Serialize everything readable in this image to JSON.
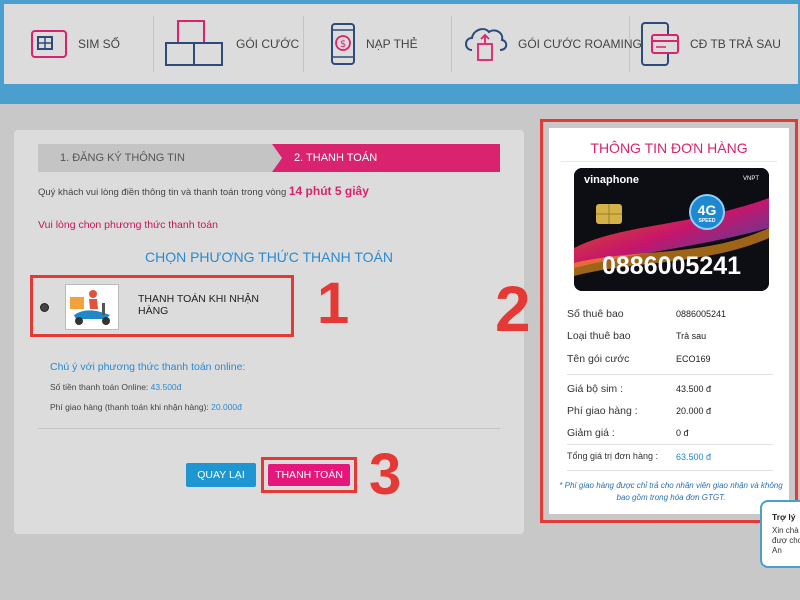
{
  "nav": {
    "items": [
      {
        "label": "SIM SỐ",
        "icon": "sim-card-icon"
      },
      {
        "label": "GÓI CƯỚC",
        "icon": "package-boxes-icon"
      },
      {
        "label": "NẠP THẺ",
        "icon": "phone-topup-icon"
      },
      {
        "label": "GÓI CƯỚC ROAMING",
        "icon": "cloud-roaming-icon"
      },
      {
        "label": "CĐ TB TRẢ SAU",
        "icon": "postpaid-phone-icon"
      }
    ]
  },
  "steps": {
    "step1": "1. ĐĂNG KÝ THÔNG TIN",
    "step2": "2. THANH TOÁN"
  },
  "notice": {
    "text": "Quý khách vui lòng điền thông tin và thanh toán trong vòng ",
    "time": "14 phút 5 giây"
  },
  "choose_hint": "Vui lòng chọn phương thức thanh toán",
  "section_title": "CHỌN PHƯƠNG THỨC THANH TOÁN",
  "payment_option": {
    "label": "THANH TOÁN KHI NHẬN HÀNG",
    "selected": true
  },
  "online_note": {
    "title": "Chú ý với phương thức thanh toán online:",
    "amount_label": "Số tiền thanh toán Online: ",
    "amount_value": "43.500đ",
    "shipping_label": "Phí giao hàng (thanh toán khi nhận hàng): ",
    "shipping_value": "20.000đ"
  },
  "buttons": {
    "back": "QUAY LẠI",
    "pay": "THANH TOÁN"
  },
  "annotations": {
    "n1": "1",
    "n2": "2",
    "n3": "3"
  },
  "order": {
    "title": "THÔNG TIN ĐƠN HÀNG",
    "card": {
      "brand": "vinaphone",
      "vnpt": "VNPT",
      "badge": "4G",
      "badge_sub": "SPEED",
      "number": "0886005241"
    },
    "rows": [
      {
        "label": "Số thuê bao",
        "value": "0886005241"
      },
      {
        "label": "Loại thuê bao",
        "value": "Trả sau"
      },
      {
        "label": "Tên gói cước",
        "value": "ECO169"
      }
    ],
    "prices": [
      {
        "label": "Giá bộ sim :",
        "value": "43.500 đ"
      },
      {
        "label": "Phí giao hàng :",
        "value": "20.000 đ"
      },
      {
        "label": "Giảm giá :",
        "value": "0 đ"
      }
    ],
    "total": {
      "label": "Tổng giá trị đơn hàng :",
      "value": "63.500 đ"
    },
    "footnote": "* Phí giao hàng được chỉ trả cho nhân viên giao nhận và không bao gồm trong hóa đơn GTGT."
  },
  "chat": {
    "title": "Trợ lý",
    "text": "Xin chà vui đượ cho An"
  },
  "colors": {
    "brand_pink": "#d9236e",
    "accent_blue": "#1e96d1",
    "annotation_red": "#e53935",
    "header_blue": "#4a9fcf"
  }
}
